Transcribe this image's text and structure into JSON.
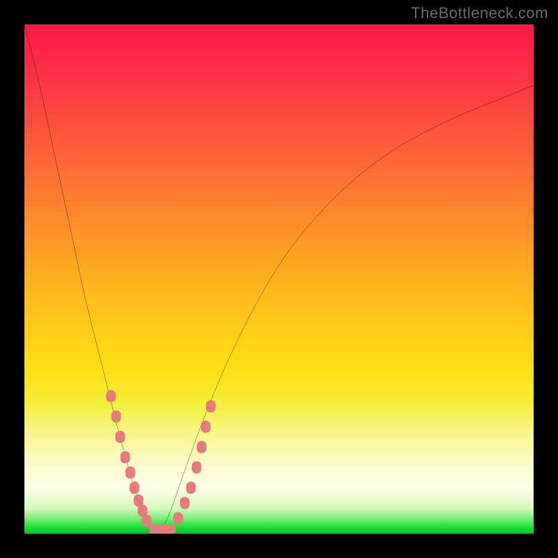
{
  "watermark": {
    "text": "TheBottleneck.com"
  },
  "chart_data": {
    "type": "line",
    "title": "",
    "xlabel": "",
    "ylabel": "",
    "xlim": [
      0,
      100
    ],
    "ylim": [
      0,
      100
    ],
    "grid": false,
    "legend": false,
    "background_gradient": {
      "orientation": "vertical",
      "stops": [
        {
          "pos": 0.0,
          "color": "#fe1a49"
        },
        {
          "pos": 0.38,
          "color": "#fe8a2b"
        },
        {
          "pos": 0.68,
          "color": "#fee015"
        },
        {
          "pos": 0.91,
          "color": "#fdfde8"
        },
        {
          "pos": 1.0,
          "color": "#00c42a"
        }
      ],
      "meaning": "heat-map style: top=high bottleneck, bottom green=optimal"
    },
    "series": [
      {
        "name": "bottleneck-curve",
        "color": "#000000",
        "style": "solid",
        "comment": "V-shaped curve; minimum ~0 at x≈26; values estimated from plot",
        "x": [
          0,
          3,
          6,
          9,
          12,
          15,
          18,
          21,
          23.5,
          26,
          28.5,
          31,
          35,
          40,
          46,
          53,
          62,
          72,
          83,
          95,
          100
        ],
        "y": [
          100,
          88,
          74,
          60,
          46,
          34,
          22,
          11,
          4,
          0,
          4,
          11,
          22,
          34,
          46,
          57,
          67,
          75,
          81,
          86,
          88
        ]
      },
      {
        "name": "sample-markers",
        "color": "#e57b7b",
        "style": "markers",
        "marker": "rounded-rect",
        "comment": "clustered salmon points along lower V flanks and base",
        "points": [
          {
            "x": 17.0,
            "y": 27
          },
          {
            "x": 18.0,
            "y": 23
          },
          {
            "x": 18.8,
            "y": 19
          },
          {
            "x": 19.8,
            "y": 15
          },
          {
            "x": 20.8,
            "y": 12
          },
          {
            "x": 21.6,
            "y": 9
          },
          {
            "x": 22.4,
            "y": 6.5
          },
          {
            "x": 23.2,
            "y": 4.5
          },
          {
            "x": 24.0,
            "y": 2.5
          },
          {
            "x": 25.5,
            "y": 0.7
          },
          {
            "x": 27.0,
            "y": 0.7
          },
          {
            "x": 28.7,
            "y": 0.7
          },
          {
            "x": 30.2,
            "y": 3
          },
          {
            "x": 31.5,
            "y": 6
          },
          {
            "x": 32.7,
            "y": 9
          },
          {
            "x": 33.8,
            "y": 13
          },
          {
            "x": 34.8,
            "y": 17
          },
          {
            "x": 35.6,
            "y": 21
          },
          {
            "x": 36.6,
            "y": 25
          }
        ]
      }
    ]
  }
}
